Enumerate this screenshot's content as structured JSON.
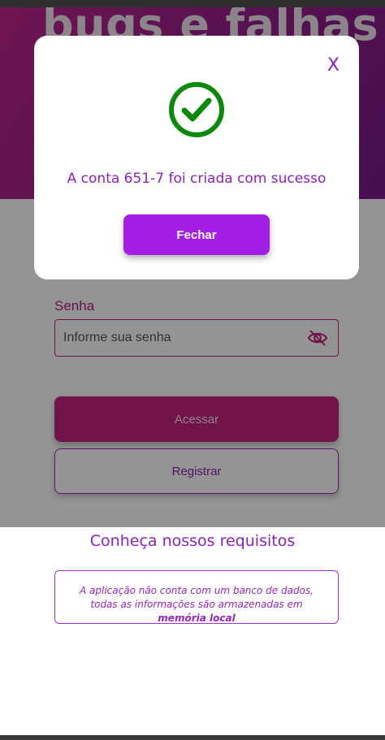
{
  "hero": {
    "title": "bugs e falhas"
  },
  "form": {
    "password_label": "Senha",
    "password_placeholder": "Informe sua senha",
    "eye_icon": "eye-slash-icon",
    "login_label": "Acessar",
    "register_label": "Registrar"
  },
  "footer": {
    "requirements_link": "Conheça nossos requisitos",
    "info_text": "A aplicação não conta com um banco de dados, todas as informações são armazenadas em",
    "info_bold": "memória local"
  },
  "modal": {
    "close_label": "X",
    "icon": "check-circle-icon",
    "message": "A conta 651-7 foi criada com sucesso",
    "button_label": "Fechar"
  },
  "colors": {
    "hero_gradient_start": "#c0248c",
    "hero_gradient_end": "#7a1a8a",
    "accent_purple": "#a51ee6",
    "accent_pink": "#c52280",
    "success_green": "#0a8a0a"
  }
}
